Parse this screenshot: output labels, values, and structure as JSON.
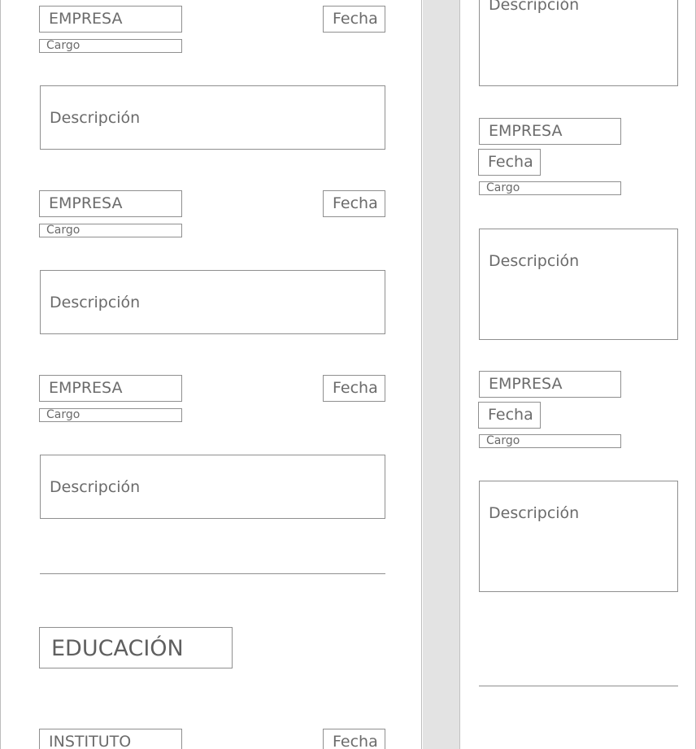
{
  "experience": {
    "company_placeholder": "EMPRESA",
    "date_placeholder": "Fecha",
    "role_placeholder": "Cargo",
    "description_placeholder": "Descripción"
  },
  "education": {
    "section_title": "EDUCACIÓN",
    "institute_placeholder": "INSTITUTO",
    "date_placeholder": "Fecha"
  }
}
